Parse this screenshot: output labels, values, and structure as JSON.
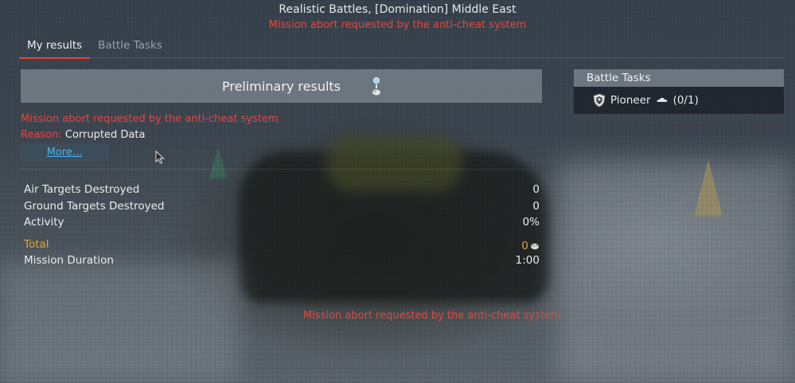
{
  "header": {
    "subtitle": "Realistic Battles, [Domination] Middle East",
    "warning": "Mission abort requested by the anti-cheat system"
  },
  "tabs": [
    {
      "label": "My results",
      "active": true
    },
    {
      "label": "Battle Tasks",
      "active": false
    }
  ],
  "results": {
    "title": "Preliminary results",
    "abort_message": "Mission abort requested by the anti-cheat system",
    "reason_label": "Reason:",
    "reason_value": "Corrupted Data",
    "more_label": "More..."
  },
  "stats": [
    {
      "label": "Air Targets Destroyed",
      "value": "0"
    },
    {
      "label": "Ground Targets Destroyed",
      "value": "0"
    },
    {
      "label": "Activity",
      "value": "0%"
    }
  ],
  "total": {
    "label": "Total",
    "value": "0"
  },
  "duration": {
    "label": "Mission Duration",
    "value": "1:00"
  },
  "bottom_warning": "Mission abort requested by the anti-cheat system",
  "battle_tasks": {
    "title": "Battle Tasks",
    "items": [
      {
        "name": "Pioneer",
        "progress": "(0/1)",
        "icon": "shield-icon",
        "vehicle_icon": "aircraft-icon"
      }
    ]
  },
  "colors": {
    "warning_red": "#e0473f",
    "link_blue": "#4cb2ec",
    "total_gold": "#d9a43a",
    "tab_active_underline": "#d83a30"
  }
}
